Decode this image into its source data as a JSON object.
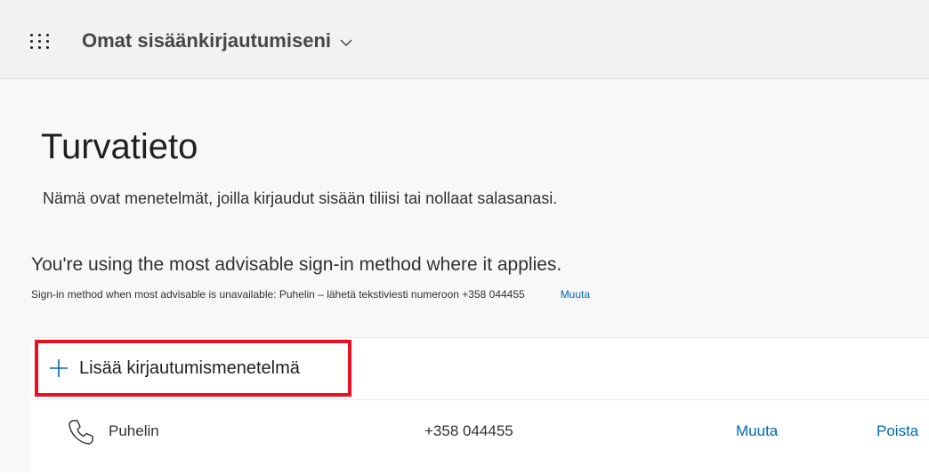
{
  "header": {
    "app_title": "Omat sisäänkirjautumiseni"
  },
  "page": {
    "title": "Turvatieto",
    "description": "Nämä ovat menetelmät, joilla kirjaudut sisään tiliisi tai nollaat salasanasi.",
    "advisable_text": "You're using the most advisable sign-in method where it applies.",
    "fallback_text": "Sign-in method when most advisable is unavailable: Puhelin – lähetä tekstiviesti numeroon +358 044455",
    "fallback_change_link": "Muuta"
  },
  "methods_panel": {
    "add_method_label": "Lisää kirjautumismenetelmä",
    "rows": [
      {
        "type": "Puhelin",
        "value": "+358 044455",
        "change_label": "Muuta",
        "delete_label": "Poista"
      }
    ]
  },
  "colors": {
    "accent_link": "#0067b8",
    "highlight_box": "#e81123",
    "header_bg": "#f3f2f1",
    "content_bg": "#f8f8f8"
  },
  "icons": {
    "waffle": "waffle-icon",
    "chevron": "chevron-down-icon",
    "plus": "plus-icon",
    "phone": "phone-icon"
  }
}
